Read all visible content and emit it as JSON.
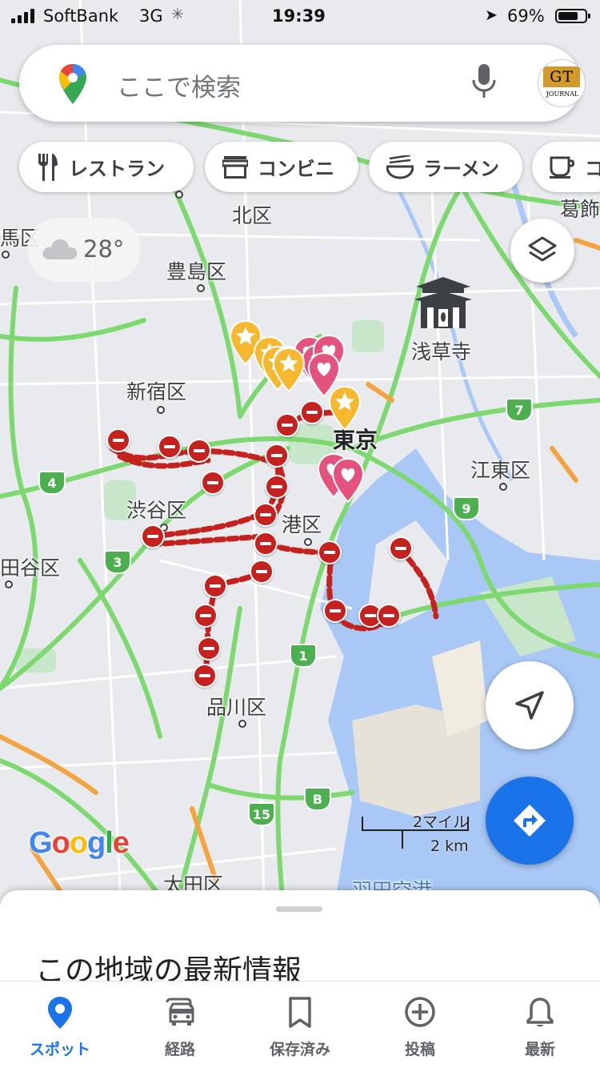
{
  "status_bar": {
    "carrier": "SoftBank",
    "network": "3G",
    "time": "19:39",
    "battery": "69%"
  },
  "search": {
    "placeholder": "ここで検索",
    "avatar_top": "GT",
    "avatar_bottom": "JOURNAL"
  },
  "chips": [
    {
      "label": "レストラン",
      "icon": "fork-knife-icon"
    },
    {
      "label": "コンビニ",
      "icon": "store-icon"
    },
    {
      "label": "ラーメン",
      "icon": "ramen-bowl-icon"
    },
    {
      "label": "コ",
      "icon": "coffee-cup-icon"
    }
  ],
  "weather": {
    "temperature": "28°",
    "icon": "cloud-icon"
  },
  "map": {
    "labels": {
      "kita": "北区",
      "katsushika": "葛飾",
      "nerima": "馬区",
      "toshima": "豊島区",
      "asakusa": "浅草寺",
      "shinjuku": "新宿区",
      "tokyo": "東京",
      "koto": "江東区",
      "shibuya": "渋谷区",
      "minato": "港区",
      "setagaya": "田谷区",
      "shinagawa": "品川区",
      "ota": "太田区",
      "haneda": "羽田空港"
    },
    "route_shields": {
      "r7": "7",
      "r4": "4",
      "r9": "9",
      "r3": "3",
      "r1": "1",
      "r15": "15",
      "rB": "B"
    },
    "scale": {
      "miles": "2マイル",
      "km": "2 km"
    },
    "logo": "Google",
    "colors": {
      "traffic_fast": "#7dd870",
      "traffic_slow": "#f4a341",
      "closure": "#c5221f",
      "water": "#a9c8f5",
      "park": "#c8e6c9"
    }
  },
  "sheet": {
    "title": "この地域の最新情報"
  },
  "tabs": [
    {
      "label": "スポット",
      "icon": "pin-icon",
      "active": true
    },
    {
      "label": "経路",
      "icon": "car-icon"
    },
    {
      "label": "保存済み",
      "icon": "bookmark-icon"
    },
    {
      "label": "投稿",
      "icon": "add-circle-icon"
    },
    {
      "label": "最新",
      "icon": "bell-icon"
    }
  ]
}
